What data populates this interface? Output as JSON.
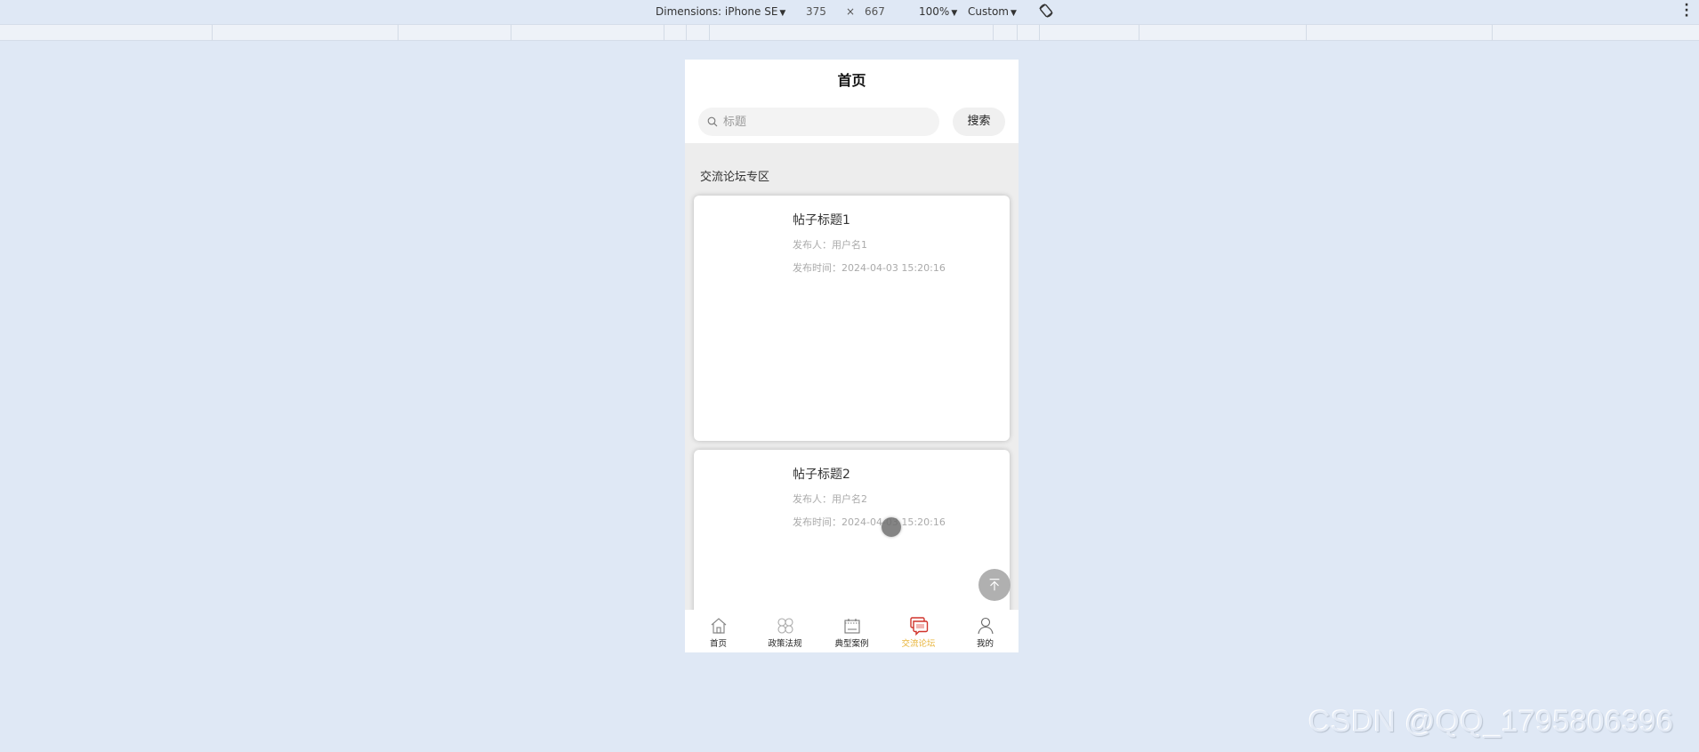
{
  "devtools": {
    "device_label": "Dimensions: iPhone SE",
    "width": "375",
    "times": "×",
    "height": "667",
    "zoom": "100%",
    "throttle": "Custom",
    "rotate_icon": "rotate-icon",
    "more_icon": "more-vertical-icon"
  },
  "app": {
    "page_title": "首页",
    "search": {
      "placeholder": "标题",
      "value": "",
      "icon": "search-icon",
      "button_label": "搜索"
    },
    "section_title": "交流论坛专区",
    "posts": [
      {
        "title": "帖子标题1",
        "author": "发布人：用户名1",
        "time": "发布时间：2024-04-03 15:20:16"
      },
      {
        "title": "帖子标题2",
        "author": "发布人：用户名2",
        "time": "发布时间：2024-04-03 15:20:16"
      }
    ],
    "back_to_top_icon": "arrow-up-to-top-icon",
    "tabbar": {
      "active_index": 3,
      "active_color": "#e8b43a",
      "items": [
        {
          "label": "首页",
          "icon": "home-icon"
        },
        {
          "label": "政策法规",
          "icon": "grid-clover-icon"
        },
        {
          "label": "典型案例",
          "icon": "calendar-board-icon"
        },
        {
          "label": "交流论坛",
          "icon": "chat-bubbles-icon"
        },
        {
          "label": "我的",
          "icon": "user-icon"
        }
      ]
    }
  },
  "watermark": "CSDN @QQ_1795806396"
}
